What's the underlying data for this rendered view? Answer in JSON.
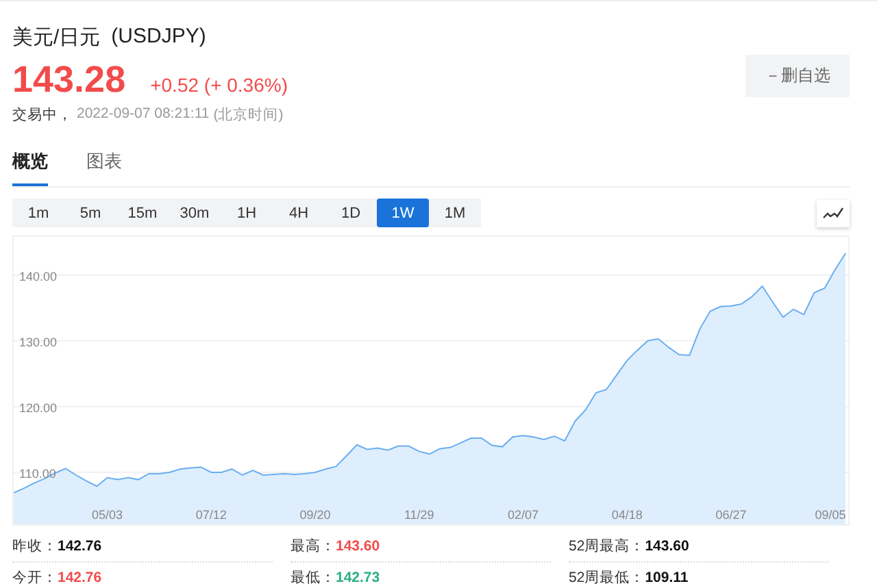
{
  "header": {
    "name": "美元/日元",
    "symbol": "(USDJPY)",
    "price": "143.28",
    "change": "+0.52 (+ 0.36%)",
    "status": "交易中，",
    "time": "2022-09-07 08:21:11",
    "timezone": "(北京时间)",
    "watchlist_button": "－删自选"
  },
  "tabs": [
    {
      "label": "概览",
      "selected": true
    },
    {
      "label": "图表",
      "selected": false
    }
  ],
  "periods": [
    {
      "label": "1m",
      "selected": false
    },
    {
      "label": "5m",
      "selected": false
    },
    {
      "label": "15m",
      "selected": false
    },
    {
      "label": "30m",
      "selected": false
    },
    {
      "label": "1H",
      "selected": false
    },
    {
      "label": "4H",
      "selected": false
    },
    {
      "label": "1D",
      "selected": false
    },
    {
      "label": "1W",
      "selected": true
    },
    {
      "label": "1M",
      "selected": false
    }
  ],
  "chart": {
    "chart_data": {
      "type": "area",
      "grid": true,
      "categories": [
        null,
        null,
        null,
        null,
        null,
        null,
        null,
        null,
        null,
        "05/03",
        null,
        null,
        null,
        null,
        null,
        null,
        null,
        null,
        null,
        "07/12",
        null,
        null,
        null,
        null,
        null,
        null,
        null,
        null,
        null,
        "09/20",
        null,
        null,
        null,
        null,
        null,
        null,
        null,
        null,
        null,
        "11/29",
        null,
        null,
        null,
        null,
        null,
        null,
        null,
        null,
        null,
        "02/07",
        null,
        null,
        null,
        null,
        null,
        null,
        null,
        null,
        null,
        "04/18",
        null,
        null,
        null,
        null,
        null,
        null,
        null,
        null,
        null,
        "06/27",
        null,
        null,
        null,
        null,
        null,
        null,
        null,
        null,
        null,
        "09/05",
        null
      ],
      "ylim": [
        102.1,
        145.8
      ],
      "yticks": [
        {
          "value": 110,
          "label": "110.00"
        },
        {
          "value": 120,
          "label": "120.00"
        },
        {
          "value": 130,
          "label": "130.00"
        },
        {
          "value": 140,
          "label": "140.00"
        }
      ],
      "series": [
        {
          "color": "#6aaef0",
          "values": [
            106.9,
            107.6,
            108.4,
            109.1,
            109.9,
            110.6,
            109.6,
            108.7,
            107.9,
            109.2,
            108.9,
            109.2,
            108.9,
            109.8,
            109.8,
            110.0,
            110.5,
            110.7,
            110.8,
            110.0,
            110.0,
            110.5,
            109.6,
            110.3,
            109.6,
            109.7,
            109.8,
            109.7,
            109.8,
            110.0,
            110.5,
            110.9,
            112.5,
            114.2,
            113.5,
            113.7,
            113.4,
            114.0,
            114.0,
            113.2,
            112.8,
            113.6,
            113.8,
            114.5,
            115.2,
            115.2,
            114.1,
            113.9,
            115.4,
            115.6,
            115.4,
            115.0,
            115.5,
            114.8,
            117.8,
            119.5,
            122.1,
            122.6,
            124.8,
            127.0,
            128.6,
            130.0,
            130.3,
            129.0,
            127.9,
            127.8,
            131.8,
            134.5,
            135.2,
            135.3,
            135.6,
            136.7,
            138.3,
            135.9,
            133.6,
            134.8,
            134.0,
            137.3,
            138.0,
            140.8,
            143.3
          ]
        }
      ]
    }
  },
  "stats": [
    {
      "label": "昨收：",
      "value": "142.76",
      "color": "#111111"
    },
    {
      "label": "最高：",
      "value": "143.60",
      "color": "#f24b4b"
    },
    {
      "label": "52周最高：",
      "value": "143.60",
      "color": "#111111"
    },
    {
      "label": "今开：",
      "value": "142.76",
      "color": "#f24b4b"
    },
    {
      "label": "最低：",
      "value": "142.73",
      "color": "#2bb07e"
    },
    {
      "label": "52周最低：",
      "value": "109.11",
      "color": "#111111"
    }
  ]
}
